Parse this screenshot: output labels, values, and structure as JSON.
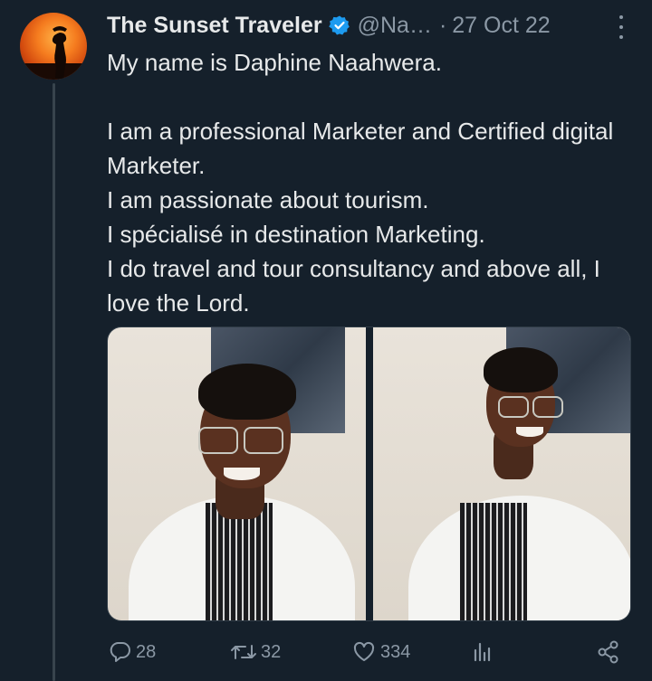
{
  "tweet": {
    "author_name": "The Sunset Traveler",
    "handle": "@Na…",
    "separator": "·",
    "date": "27 Oct 22",
    "text_lines": [
      "My name is Daphine Naahwera.",
      "",
      "I am a professional Marketer and Certified digital Marketer.",
      "I am passionate about tourism.",
      "I spécialisé in destination Marketing.",
      "I do travel and tour consultancy and above all, I love the Lord."
    ],
    "text": "My name is Daphine Naahwera.\n\nI am a professional Marketer and Certified digital Marketer.\nI am passionate about tourism.\nI spécialisé in destination Marketing.\nI do travel and tour consultancy and above all, I love the Lord."
  },
  "icons": {
    "verified": "verified-badge-icon",
    "more": "more-options-icon",
    "reply": "reply-icon",
    "retweet": "retweet-icon",
    "like": "heart-icon",
    "views": "views-chart-icon",
    "share": "share-icon"
  },
  "stats": {
    "replies": "28",
    "retweets": "32",
    "likes": "334"
  },
  "colors": {
    "background": "#15202b",
    "text": "#e7e9ea",
    "muted": "#8b98a5",
    "verified": "#1d9bf0"
  }
}
